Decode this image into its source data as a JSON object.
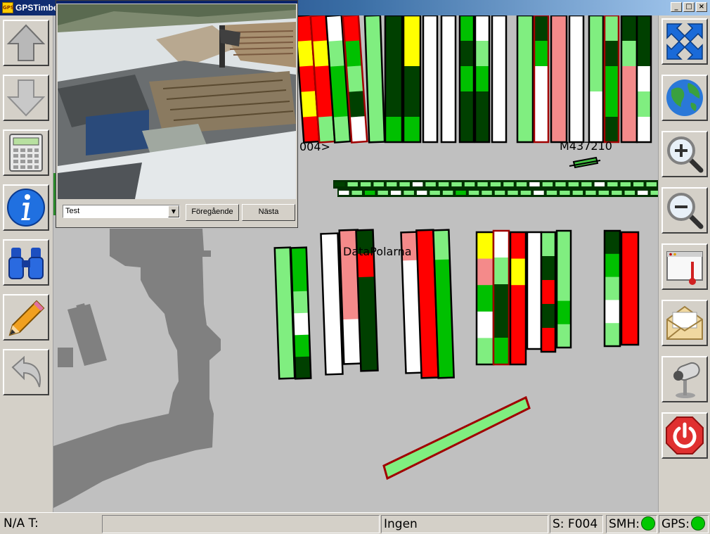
{
  "window": {
    "title": "GPSTimbe",
    "app_icon": "gps-icon",
    "controls": [
      "_",
      "□",
      "×"
    ]
  },
  "map": {
    "labels": {
      "area_a": "004>",
      "marker": "M437210",
      "company": "DataPolarna"
    },
    "colors": {
      "background": "#c0c0c0",
      "building": "#808080",
      "light_green": "#80ee80",
      "green": "#00c000",
      "dark_green": "#004000",
      "red": "#ff0000",
      "pink": "#f48a8a",
      "yellow": "#ffff00",
      "white": "#ffffff"
    }
  },
  "left_toolbar": [
    {
      "name": "scroll-up",
      "icon": "arrow-up-icon"
    },
    {
      "name": "scroll-down",
      "icon": "arrow-down-icon"
    },
    {
      "name": "calculator",
      "icon": "calculator-icon"
    },
    {
      "name": "info",
      "icon": "info-icon"
    },
    {
      "name": "search",
      "icon": "binoculars-icon"
    },
    {
      "name": "edit",
      "icon": "pencil-icon"
    },
    {
      "name": "undo",
      "icon": "undo-arrow-icon"
    }
  ],
  "right_toolbar": [
    {
      "name": "fit-view",
      "icon": "expand-arrows-icon"
    },
    {
      "name": "world-view",
      "icon": "globe-icon"
    },
    {
      "name": "zoom-in",
      "icon": "zoom-in-icon"
    },
    {
      "name": "zoom-out",
      "icon": "zoom-out-icon"
    },
    {
      "name": "window",
      "icon": "window-thermometer-icon"
    },
    {
      "name": "messages",
      "icon": "envelope-icon"
    },
    {
      "name": "camera",
      "icon": "webcam-icon"
    },
    {
      "name": "exit",
      "icon": "power-icon"
    }
  ],
  "camera_popup": {
    "select_value": "Test",
    "prev_label": "Föregående",
    "next_label": "Nästa"
  },
  "statusbar": {
    "na_label": "N/A T:",
    "info": "",
    "mode": "Ingen",
    "sensor": "S: F004",
    "smh_label": "SMH:",
    "gps_label": "GPS:",
    "smh_status": "ok",
    "gps_status": "ok"
  }
}
